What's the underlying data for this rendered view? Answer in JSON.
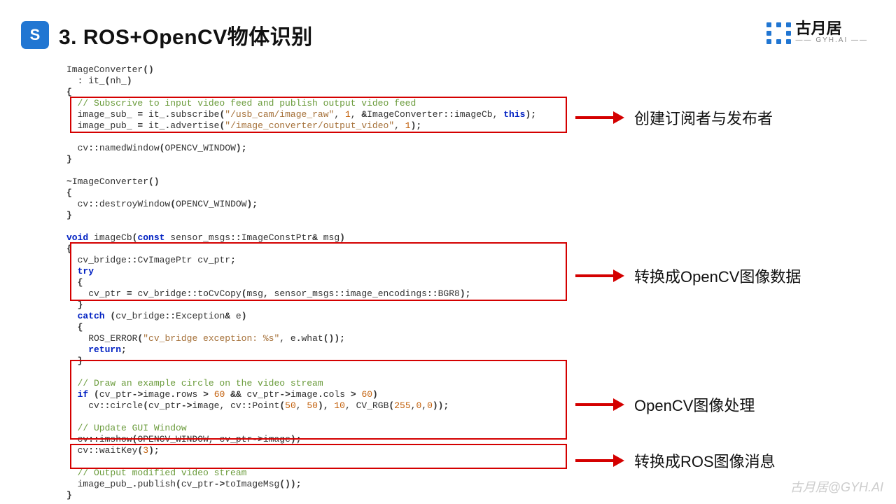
{
  "header": {
    "title": "3. ROS+OpenCV物体识别",
    "logo_glyph": "S"
  },
  "brand": {
    "cn": "古月居",
    "en": "—— GYH.AI ——"
  },
  "code": {
    "l01": "ImageConverter",
    "l01b": "()",
    "l02a": "  : it_",
    "l02b": "(",
    "l02c": "nh_",
    "l02d": ")",
    "l03": "{",
    "l04a": "  // Subscrive to input video feed and publish output video feed",
    "l05a": "  image_sub_ ",
    "l05b": "=",
    "l05c": " it_",
    "l05d": ".",
    "l05e": "subscribe",
    "l05f": "(",
    "l05g": "\"/usb_cam/image_raw\"",
    "l05h": ", ",
    "l05i": "1",
    "l05j": ", ",
    "l05k": "&",
    "l05l": "ImageConverter",
    "l05m": "::",
    "l05n": "imageCb",
    "l05o": ", ",
    "l05p": "this",
    "l05q": ");",
    "l06a": "  image_pub_ ",
    "l06b": "=",
    "l06c": " it_",
    "l06d": ".",
    "l06e": "advertise",
    "l06f": "(",
    "l06g": "\"/image_converter/output_video\"",
    "l06h": ", ",
    "l06i": "1",
    "l06j": ");",
    "l07": "",
    "l08a": "  cv",
    "l08b": "::",
    "l08c": "namedWindow",
    "l08d": "(",
    "l08e": "OPENCV_WINDOW",
    "l08f": ");",
    "l09": "}",
    "l10": "",
    "l11a": "~",
    "l11b": "ImageConverter",
    "l11c": "()",
    "l12": "{",
    "l13a": "  cv",
    "l13b": "::",
    "l13c": "destroyWindow",
    "l13d": "(",
    "l13e": "OPENCV_WINDOW",
    "l13f": ");",
    "l14": "}",
    "l15": "",
    "l16a": "void",
    "l16b": " imageCb",
    "l16c": "(",
    "l16d": "const",
    "l16e": " sensor_msgs",
    "l16f": "::",
    "l16g": "ImageConstPtr",
    "l16h": "&",
    "l16i": " msg",
    "l16j": ")",
    "l17": "{",
    "l18a": "  cv_bridge",
    "l18b": "::",
    "l18c": "CvImagePtr cv_ptr",
    "l18d": ";",
    "l19": "  try",
    "l20": "  {",
    "l21a": "    cv_ptr ",
    "l21b": "=",
    "l21c": " cv_bridge",
    "l21d": "::",
    "l21e": "toCvCopy",
    "l21f": "(",
    "l21g": "msg",
    "l21h": ",",
    "l21i": " sensor_msgs",
    "l21j": "::",
    "l21k": "image_encodings",
    "l21l": "::",
    "l21m": "BGR8",
    "l21n": ");",
    "l22": "  }",
    "l23a": "  catch",
    "l23b": " (",
    "l23c": "cv_bridge",
    "l23d": "::",
    "l23e": "Exception",
    "l23f": "&",
    "l23g": " e",
    "l23h": ")",
    "l24": "  {",
    "l25a": "    ROS_ERROR",
    "l25b": "(",
    "l25c": "\"cv_bridge exception: %s\"",
    "l25d": ", e",
    "l25e": ".",
    "l25f": "what",
    "l25g": "());",
    "l26": "    return",
    "l26b": ";",
    "l27": "  }",
    "l28": "",
    "l29": "  // Draw an example circle on the video stream",
    "l30a": "  if",
    "l30b": " (",
    "l30c": "cv_ptr",
    "l30d": "->",
    "l30e": "image",
    "l30f": ".",
    "l30g": "rows ",
    "l30h": ">",
    "l30i": " ",
    "l30j": "60",
    "l30k": " ",
    "l30l": "&&",
    "l30m": " cv_ptr",
    "l30n": "->",
    "l30o": "image",
    "l30p": ".",
    "l30q": "cols ",
    "l30r": ">",
    "l30s": " ",
    "l30t": "60",
    "l30u": ")",
    "l31a": "    cv",
    "l31b": "::",
    "l31c": "circle",
    "l31d": "(",
    "l31e": "cv_ptr",
    "l31f": "->",
    "l31g": "image",
    "l31h": ", cv",
    "l31i": "::",
    "l31j": "Point",
    "l31k": "(",
    "l31l": "50",
    "l31m": ", ",
    "l31n": "50",
    "l31o": "), ",
    "l31p": "10",
    "l31q": ", CV_RGB",
    "l31r": "(",
    "l31s": "255",
    "l31t": ",",
    "l31u": "0",
    "l31v": ",",
    "l31w": "0",
    "l31x": "));",
    "l32": "",
    "l33": "  // Update GUI Window",
    "l34a": "  cv",
    "l34b": "::",
    "l34c": "imshow",
    "l34d": "(",
    "l34e": "OPENCV_WINDOW",
    "l34f": ", cv_ptr",
    "l34g": "->",
    "l34h": "image",
    "l34i": ");",
    "l35a": "  cv",
    "l35b": "::",
    "l35c": "waitKey",
    "l35d": "(",
    "l35e": "3",
    "l35f": ");",
    "l36": "",
    "l37": "  // Output modified video stream",
    "l38a": "  image_pub_",
    "l38b": ".",
    "l38c": "publish",
    "l38d": "(",
    "l38e": "cv_ptr",
    "l38f": "->",
    "l38g": "toImageMsg",
    "l38h": "());",
    "l39": "}"
  },
  "annotations": {
    "a1": "创建订阅者与发布者",
    "a2": "转换成OpenCV图像数据",
    "a3": "OpenCV图像处理",
    "a4": "转换成ROS图像消息"
  },
  "watermark": "古月居@GYH.AI"
}
